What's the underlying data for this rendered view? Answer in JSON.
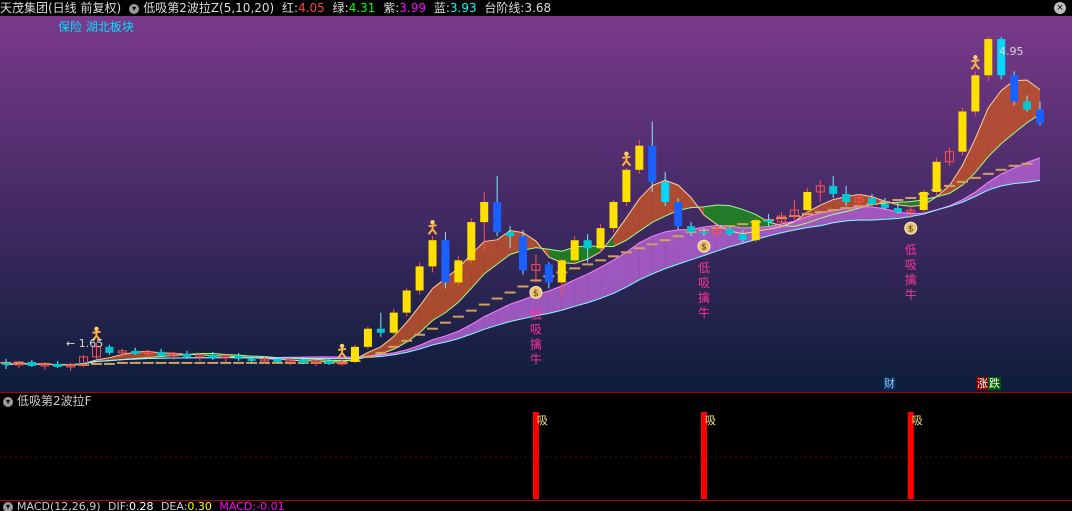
{
  "header": {
    "stock_title": "天茂集团(日线 前复权)",
    "indicator_name": "低吸第2波拉Z(5,10,20)",
    "red_label": "红:",
    "red_value": "4.05",
    "green_label": "绿:",
    "green_value": "4.31",
    "purple_label": "紫:",
    "purple_value": "3.99",
    "blue_label": "蓝:",
    "blue_value": "3.93",
    "step_label": "台阶线:",
    "step_value": "3.68"
  },
  "main": {
    "sector_tag": "保险 湖北板块",
    "price_high": "4.95",
    "price_low": "← 1.65",
    "buy_text": "低吸擒牛",
    "markers": {
      "cai": "财",
      "zhang": "涨",
      "die": "跌"
    }
  },
  "sub": {
    "title": "低吸第2波拉F",
    "signal_label": "吸"
  },
  "macd": {
    "title": "MACD(12,26,9)",
    "dif_label": "DIF:",
    "dif_value": "0.28",
    "dea_label": "DEA:",
    "dea_value": "0.30",
    "macd_label": "MACD:",
    "macd_value": "-0.01"
  },
  "colors": {
    "red": "#ff4040",
    "green": "#00ff00",
    "purple": "#ff00ff",
    "blue": "#00ffff",
    "step": "#d2a060",
    "bg_top": "#7a3a8a",
    "bg_bottom": "#0c1d3a",
    "signal_text": "#ff3399",
    "signal_bar": "#ff0000"
  },
  "icons": [
    "dropdown-icon",
    "close-icon",
    "runner-icon",
    "money-bag-icon"
  ],
  "chart_data": {
    "type": "candlestick",
    "candles": [
      {
        "o": 1.7,
        "h": 1.74,
        "l": 1.64,
        "c": 1.68
      },
      {
        "o": 1.68,
        "h": 1.72,
        "l": 1.65,
        "c": 1.71
      },
      {
        "o": 1.71,
        "h": 1.73,
        "l": 1.66,
        "c": 1.67
      },
      {
        "o": 1.67,
        "h": 1.71,
        "l": 1.63,
        "c": 1.69
      },
      {
        "o": 1.69,
        "h": 1.72,
        "l": 1.65,
        "c": 1.66
      },
      {
        "o": 1.66,
        "h": 1.7,
        "l": 1.62,
        "c": 1.68
      },
      {
        "o": 1.68,
        "h": 1.78,
        "l": 1.66,
        "c": 1.76
      },
      {
        "o": 1.76,
        "h": 1.9,
        "l": 1.74,
        "c": 1.86
      },
      {
        "o": 1.86,
        "h": 1.88,
        "l": 1.78,
        "c": 1.8
      },
      {
        "o": 1.8,
        "h": 1.84,
        "l": 1.76,
        "c": 1.82
      },
      {
        "o": 1.82,
        "h": 1.85,
        "l": 1.78,
        "c": 1.79
      },
      {
        "o": 1.79,
        "h": 1.83,
        "l": 1.75,
        "c": 1.81
      },
      {
        "o": 1.81,
        "h": 1.84,
        "l": 1.76,
        "c": 1.77
      },
      {
        "o": 1.77,
        "h": 1.81,
        "l": 1.73,
        "c": 1.79
      },
      {
        "o": 1.79,
        "h": 1.82,
        "l": 1.74,
        "c": 1.76
      },
      {
        "o": 1.76,
        "h": 1.8,
        "l": 1.72,
        "c": 1.78
      },
      {
        "o": 1.78,
        "h": 1.81,
        "l": 1.73,
        "c": 1.75
      },
      {
        "o": 1.75,
        "h": 1.79,
        "l": 1.71,
        "c": 1.77
      },
      {
        "o": 1.77,
        "h": 1.8,
        "l": 1.72,
        "c": 1.74
      },
      {
        "o": 1.74,
        "h": 1.77,
        "l": 1.7,
        "c": 1.72
      },
      {
        "o": 1.72,
        "h": 1.76,
        "l": 1.69,
        "c": 1.74
      },
      {
        "o": 1.74,
        "h": 1.76,
        "l": 1.7,
        "c": 1.71
      },
      {
        "o": 1.71,
        "h": 1.75,
        "l": 1.68,
        "c": 1.73
      },
      {
        "o": 1.73,
        "h": 1.76,
        "l": 1.69,
        "c": 1.7
      },
      {
        "o": 1.7,
        "h": 1.73,
        "l": 1.67,
        "c": 1.72
      },
      {
        "o": 1.72,
        "h": 1.74,
        "l": 1.68,
        "c": 1.69
      },
      {
        "o": 1.69,
        "h": 1.73,
        "l": 1.67,
        "c": 1.71
      },
      {
        "o": 1.71,
        "h": 1.88,
        "l": 1.7,
        "c": 1.86
      },
      {
        "o": 1.86,
        "h": 2.06,
        "l": 1.84,
        "c": 2.04
      },
      {
        "o": 2.04,
        "h": 2.2,
        "l": 1.96,
        "c": 2.0
      },
      {
        "o": 2.0,
        "h": 2.24,
        "l": 1.98,
        "c": 2.2
      },
      {
        "o": 2.2,
        "h": 2.44,
        "l": 2.16,
        "c": 2.42
      },
      {
        "o": 2.42,
        "h": 2.7,
        "l": 2.38,
        "c": 2.66
      },
      {
        "o": 2.66,
        "h": 2.96,
        "l": 2.6,
        "c": 2.92
      },
      {
        "o": 2.92,
        "h": 3.0,
        "l": 2.44,
        "c": 2.5
      },
      {
        "o": 2.5,
        "h": 2.76,
        "l": 2.46,
        "c": 2.72
      },
      {
        "o": 2.72,
        "h": 3.14,
        "l": 2.68,
        "c": 3.1
      },
      {
        "o": 3.1,
        "h": 3.4,
        "l": 2.8,
        "c": 3.3
      },
      {
        "o": 3.3,
        "h": 3.56,
        "l": 2.96,
        "c": 3.0
      },
      {
        "o": 3.0,
        "h": 3.06,
        "l": 2.84,
        "c": 2.96
      },
      {
        "o": 2.96,
        "h": 3.02,
        "l": 2.58,
        "c": 2.62
      },
      {
        "o": 2.62,
        "h": 2.78,
        "l": 2.5,
        "c": 2.68
      },
      {
        "o": 2.68,
        "h": 2.7,
        "l": 2.44,
        "c": 2.5
      },
      {
        "o": 2.5,
        "h": 2.74,
        "l": 2.36,
        "c": 2.72
      },
      {
        "o": 2.72,
        "h": 2.96,
        "l": 2.68,
        "c": 2.92
      },
      {
        "o": 2.92,
        "h": 2.98,
        "l": 2.7,
        "c": 2.84
      },
      {
        "o": 2.84,
        "h": 3.08,
        "l": 2.8,
        "c": 3.04
      },
      {
        "o": 3.04,
        "h": 3.32,
        "l": 3.0,
        "c": 3.3
      },
      {
        "o": 3.3,
        "h": 3.64,
        "l": 3.26,
        "c": 3.62
      },
      {
        "o": 3.62,
        "h": 3.92,
        "l": 3.58,
        "c": 3.86
      },
      {
        "o": 3.86,
        "h": 4.1,
        "l": 3.4,
        "c": 3.5
      },
      {
        "o": 3.5,
        "h": 3.6,
        "l": 3.26,
        "c": 3.3
      },
      {
        "o": 3.3,
        "h": 3.34,
        "l": 3.02,
        "c": 3.06
      },
      {
        "o": 3.06,
        "h": 3.1,
        "l": 2.96,
        "c": 3.0
      },
      {
        "o": 3.0,
        "h": 3.04,
        "l": 2.96,
        "c": 2.99
      },
      {
        "o": 2.99,
        "h": 3.06,
        "l": 2.95,
        "c": 3.03
      },
      {
        "o": 3.03,
        "h": 3.05,
        "l": 2.96,
        "c": 2.98
      },
      {
        "o": 2.98,
        "h": 3.02,
        "l": 2.9,
        "c": 2.92
      },
      {
        "o": 2.92,
        "h": 3.14,
        "l": 2.9,
        "c": 3.12
      },
      {
        "o": 3.12,
        "h": 3.18,
        "l": 3.06,
        "c": 3.1
      },
      {
        "o": 3.1,
        "h": 3.2,
        "l": 3.06,
        "c": 3.16
      },
      {
        "o": 3.16,
        "h": 3.32,
        "l": 3.12,
        "c": 3.22
      },
      {
        "o": 3.22,
        "h": 3.44,
        "l": 3.18,
        "c": 3.4
      },
      {
        "o": 3.4,
        "h": 3.52,
        "l": 3.3,
        "c": 3.46
      },
      {
        "o": 3.46,
        "h": 3.56,
        "l": 3.34,
        "c": 3.38
      },
      {
        "o": 3.38,
        "h": 3.46,
        "l": 3.26,
        "c": 3.3
      },
      {
        "o": 3.3,
        "h": 3.38,
        "l": 3.24,
        "c": 3.34
      },
      {
        "o": 3.34,
        "h": 3.38,
        "l": 3.26,
        "c": 3.28
      },
      {
        "o": 3.28,
        "h": 3.34,
        "l": 3.22,
        "c": 3.24
      },
      {
        "o": 3.24,
        "h": 3.3,
        "l": 3.18,
        "c": 3.2
      },
      {
        "o": 3.2,
        "h": 3.26,
        "l": 3.14,
        "c": 3.22
      },
      {
        "o": 3.22,
        "h": 3.42,
        "l": 3.2,
        "c": 3.4
      },
      {
        "o": 3.4,
        "h": 3.74,
        "l": 3.36,
        "c": 3.7
      },
      {
        "o": 3.7,
        "h": 3.84,
        "l": 3.66,
        "c": 3.8
      },
      {
        "o": 3.8,
        "h": 4.24,
        "l": 3.76,
        "c": 4.2
      },
      {
        "o": 4.2,
        "h": 4.6,
        "l": 4.16,
        "c": 4.56
      },
      {
        "o": 4.56,
        "h": 4.95,
        "l": 4.5,
        "c": 4.92
      },
      {
        "o": 4.92,
        "h": 4.94,
        "l": 4.52,
        "c": 4.56
      },
      {
        "o": 4.56,
        "h": 4.6,
        "l": 4.26,
        "c": 4.3
      },
      {
        "o": 4.3,
        "h": 4.36,
        "l": 4.2,
        "c": 4.22
      },
      {
        "o": 4.22,
        "h": 4.3,
        "l": 4.06,
        "c": 4.08
      }
    ],
    "step_line": [
      1.7,
      1.7,
      1.69,
      1.69,
      1.68,
      1.68,
      1.68,
      1.69,
      1.69,
      1.7,
      1.7,
      1.7,
      1.7,
      1.7,
      1.7,
      1.7,
      1.7,
      1.7,
      1.7,
      1.7,
      1.7,
      1.7,
      1.7,
      1.7,
      1.7,
      1.7,
      1.7,
      1.72,
      1.76,
      1.8,
      1.86,
      1.92,
      1.98,
      2.04,
      2.1,
      2.16,
      2.22,
      2.28,
      2.34,
      2.4,
      2.46,
      2.52,
      2.56,
      2.6,
      2.64,
      2.68,
      2.72,
      2.76,
      2.8,
      2.84,
      2.88,
      2.92,
      2.96,
      3.0,
      3.02,
      3.04,
      3.06,
      3.08,
      3.1,
      3.12,
      3.14,
      3.16,
      3.18,
      3.2,
      3.22,
      3.24,
      3.26,
      3.28,
      3.3,
      3.32,
      3.34,
      3.38,
      3.42,
      3.46,
      3.5,
      3.54,
      3.58,
      3.62,
      3.66,
      3.68
    ],
    "buy_signals": [
      41,
      54,
      70
    ],
    "top_signals": [
      7,
      26,
      33,
      48,
      75
    ],
    "ylim": [
      1.55,
      5.05
    ]
  }
}
